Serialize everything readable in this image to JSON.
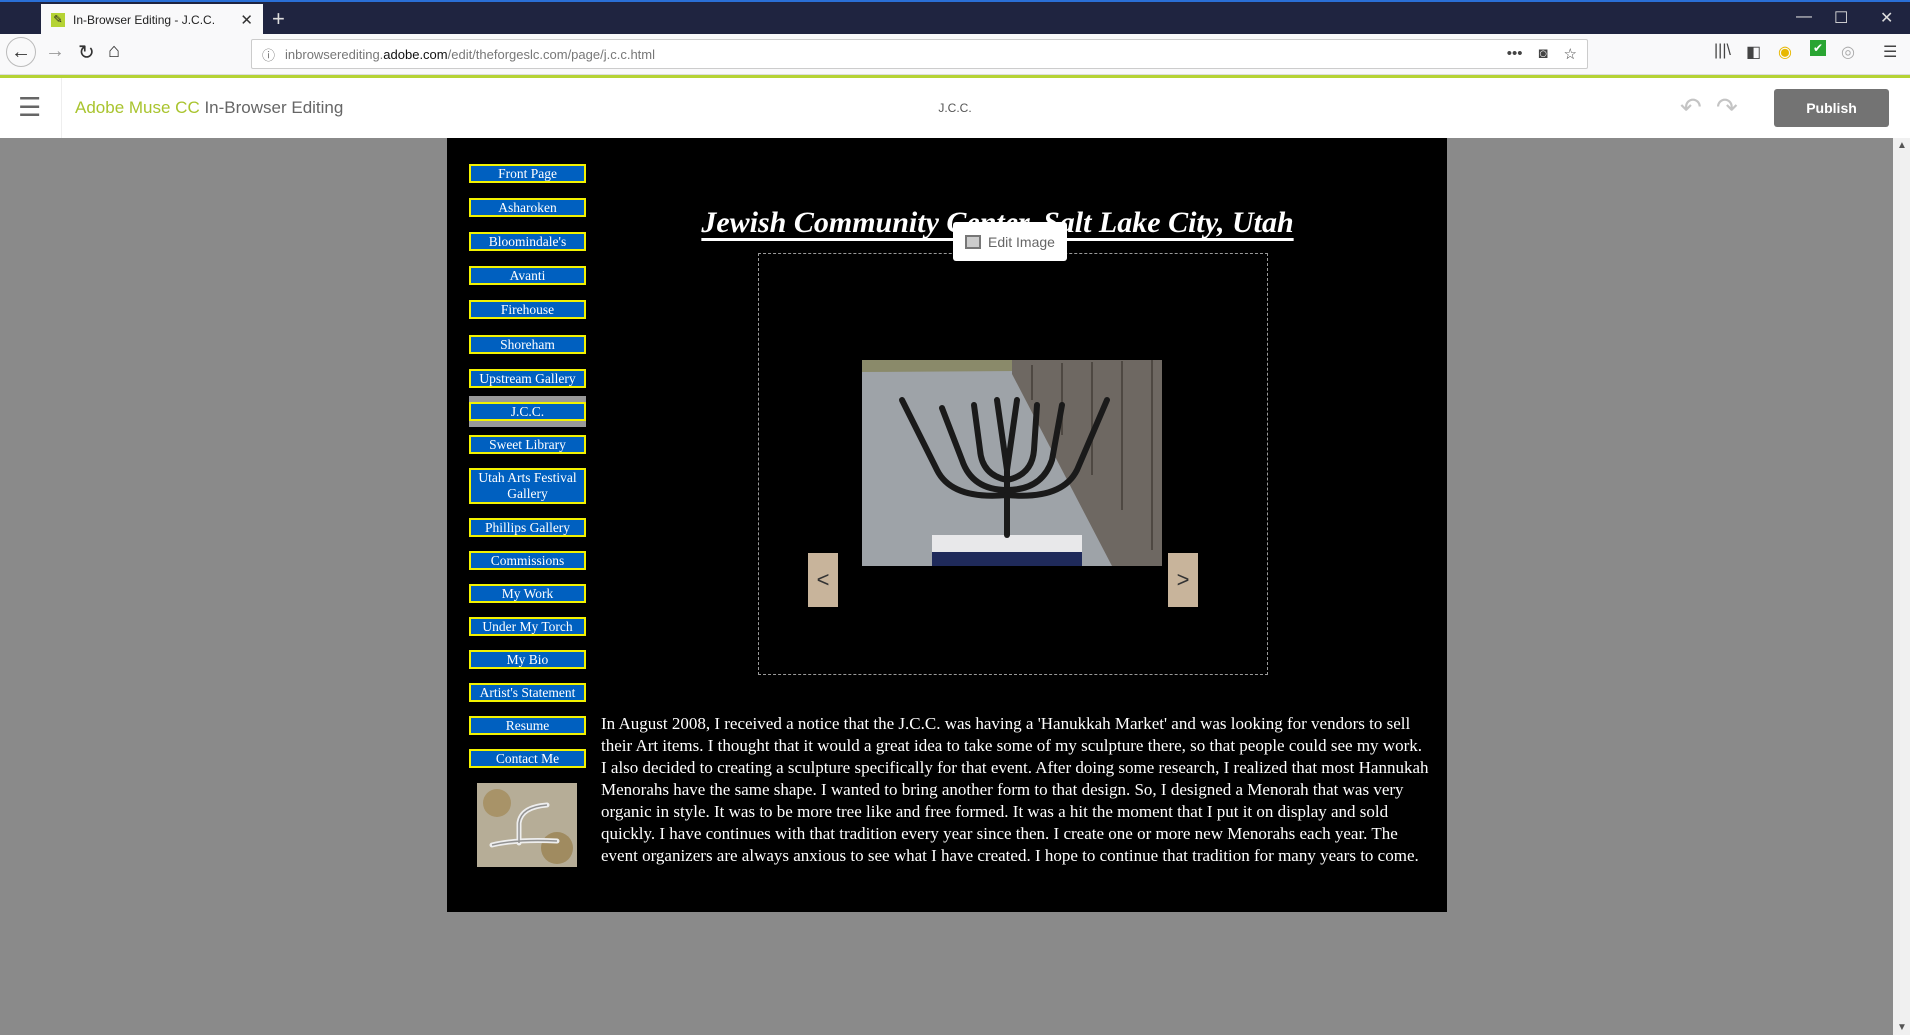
{
  "browser": {
    "tab_title": "In-Browser Editing - J.C.C.",
    "url_prefix": "inbrowserediting.",
    "url_domain": "adobe.com",
    "url_path": "/edit/theforgeslc.com/page/j.c.c.html"
  },
  "muse": {
    "brand_accent": "Adobe Muse CC",
    "brand_rest": " In-Browser Editing",
    "page_name": "J.C.C.",
    "publish_label": "Publish",
    "edit_image_label": "Edit Image",
    "accent_color": "#b5d334"
  },
  "site": {
    "nav": [
      "Front Page",
      "Asharoken",
      "Bloomindale's",
      "Avanti",
      "Firehouse",
      "Shoreham",
      "Upstream Gallery",
      "J.C.C.",
      "Sweet Library",
      "Utah Arts Festival Gallery",
      "Phillips Gallery",
      "Commissions",
      "My Work",
      "Under My Torch",
      "My Bio",
      "Artist's Statement",
      "Resume",
      "Contact Me"
    ],
    "active": "J.C.C.",
    "title": "Jewish Community Center, Salt Lake City, Utah",
    "prev_label": "<",
    "next_label": ">",
    "paragraph": "In  August 2008, I received a notice that the J.C.C. was having a 'Hanukkah Market' and was looking for vendors to sell their Art items. I thought that it would a great idea to take some of my sculpture there, so that people could see my work. I also decided to creating a sculpture specifically for that event. After doing some research, I realized that most Hannukah Menorahs have the same shape. I wanted to bring another form to that design. So, I designed a Menorah that was very organic in style. It was to be more tree like and free formed. It was a hit the moment that I put it on display and sold quickly. I have continues with that tradition every year since then. I create one or more new Menorahs each year. The event organizers are always anxious to see what I have created. I hope to continue that tradition for many years to come."
  }
}
